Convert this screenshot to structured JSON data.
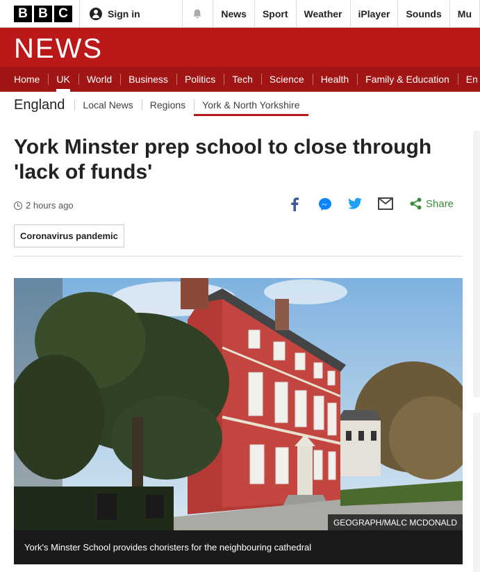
{
  "topbar": {
    "logo_letters": [
      "B",
      "B",
      "C"
    ],
    "signin_label": "Sign in",
    "links": [
      "News",
      "Sport",
      "Weather",
      "iPlayer",
      "Sounds",
      "Mu"
    ]
  },
  "banner": {
    "title": "NEWS"
  },
  "section_nav": {
    "items": [
      "Home",
      "UK",
      "World",
      "Business",
      "Politics",
      "Tech",
      "Science",
      "Health",
      "Family & Education",
      "En"
    ],
    "active": "UK"
  },
  "sub_nav": {
    "region": "England",
    "items": [
      "Local News",
      "Regions",
      "York & North Yorkshire"
    ],
    "active": "York & North Yorkshire"
  },
  "article": {
    "headline": "York Minster prep school to close through 'lack of funds'",
    "timestamp": "2 hours ago",
    "share_label": "Share",
    "tag": "Coronavirus pandemic",
    "image_credit": "GEOGRAPH/MALC MCDONALD",
    "caption": "York's Minster School provides choristers for the neighbouring cathedral"
  },
  "colors": {
    "brand_red": "#bb1919",
    "nav_red": "#a11515",
    "share_green": "#3c8c3c",
    "facebook_blue": "#3b5998",
    "twitter_blue": "#1da1f2"
  },
  "icons": [
    "user-icon",
    "bell-icon",
    "clock-icon",
    "facebook-icon",
    "messenger-icon",
    "twitter-icon",
    "email-icon",
    "share-icon"
  ]
}
